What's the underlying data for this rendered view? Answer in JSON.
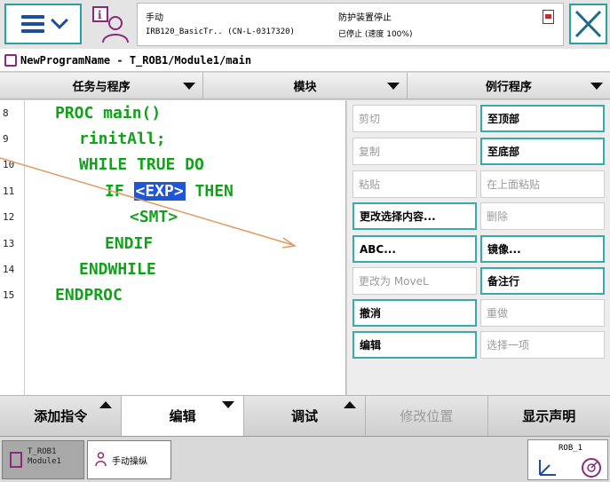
{
  "status": {
    "mode": "手动",
    "controller": "IRB120_BasicTr.. (CN-L-0317320)",
    "safety_title": "防护装置停止",
    "run_state": "已停止 (速度 100%)"
  },
  "breadcrumb": "NewProgramName - T_ROB1/Module1/main",
  "tabs": [
    "任务与程序",
    "模块",
    "例行程序"
  ],
  "code": {
    "line_numbers": [
      "8",
      "9",
      "10",
      "11",
      "12",
      "13",
      "14",
      "15"
    ],
    "lines": [
      {
        "indent": "",
        "text": "PROC main()"
      },
      {
        "indent": "  ",
        "text": "rinitAll;"
      },
      {
        "indent": "  ",
        "text": "WHILE TRUE DO"
      },
      {
        "indent": "    ",
        "pre": "IF ",
        "selected": "<EXP>",
        "post": " THEN"
      },
      {
        "indent": "      ",
        "text": "<SMT>"
      },
      {
        "indent": "    ",
        "text": "ENDIF"
      },
      {
        "indent": "  ",
        "text": "ENDWHILE"
      },
      {
        "indent": "",
        "text": "ENDPROC"
      }
    ]
  },
  "edit_menu": {
    "left": [
      {
        "label": "剪切",
        "enabled": false
      },
      {
        "label": "复制",
        "enabled": false
      },
      {
        "label": "粘贴",
        "enabled": false
      },
      {
        "label": "更改选择内容...",
        "enabled": true
      },
      {
        "label": "ABC...",
        "enabled": true
      },
      {
        "label": "更改为 MoveL",
        "enabled": false
      },
      {
        "label": "撤消",
        "enabled": true
      },
      {
        "label": "编辑",
        "enabled": true
      }
    ],
    "right": [
      {
        "label": "至顶部",
        "enabled": true
      },
      {
        "label": "至底部",
        "enabled": true
      },
      {
        "label": "在上面粘贴",
        "enabled": false
      },
      {
        "label": "删除",
        "enabled": false
      },
      {
        "label": "镜像...",
        "enabled": true
      },
      {
        "label": "备注行",
        "enabled": true
      },
      {
        "label": "重做",
        "enabled": false
      },
      {
        "label": "选择一项",
        "enabled": false
      }
    ]
  },
  "commands": [
    "添加指令",
    "编辑",
    "调试",
    "修改位置",
    "显示声明"
  ],
  "taskbar": {
    "task1_line1": "T_ROB1",
    "task1_line2": "Module1",
    "task2": "手动操纵",
    "robot": "ROB_1"
  },
  "colors": {
    "accent": "#2aa1a1",
    "code_keyword": "#11a11a",
    "selection": "#1d57d8"
  }
}
